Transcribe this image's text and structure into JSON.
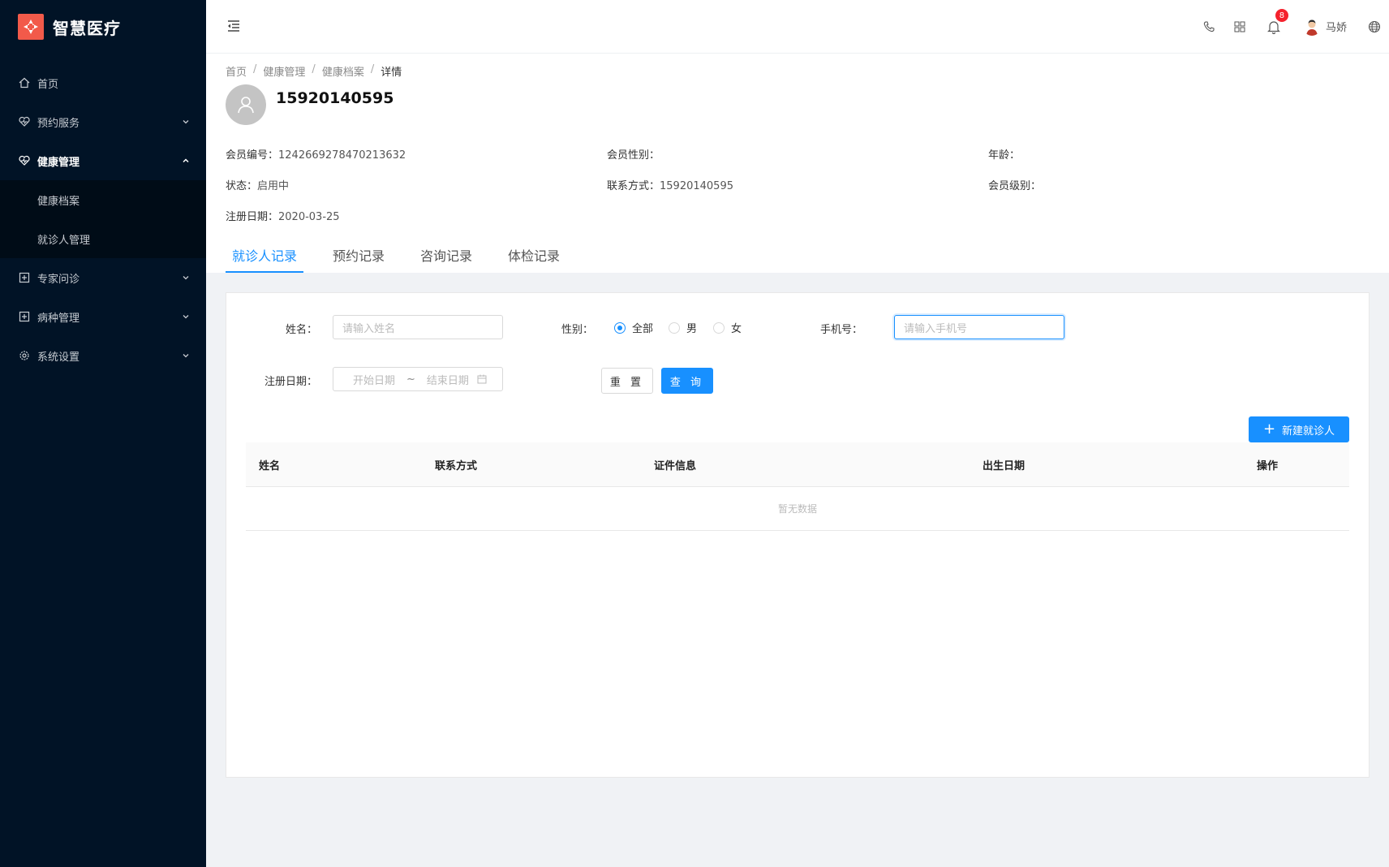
{
  "brand": {
    "title": "智慧医疗",
    "logo_color": "#f25a4a"
  },
  "sidebar": {
    "items": [
      {
        "label": "首页",
        "icon": "home-icon"
      },
      {
        "label": "预约服务",
        "icon": "heart-icon"
      },
      {
        "label": "健康管理",
        "icon": "heart-icon"
      },
      {
        "label": "专家问诊",
        "icon": "plus-square-icon"
      },
      {
        "label": "病种管理",
        "icon": "plus-square-icon"
      },
      {
        "label": "系统设置",
        "icon": "gear-icon"
      }
    ],
    "submenu": [
      {
        "label": "健康档案"
      },
      {
        "label": "就诊人管理"
      }
    ]
  },
  "topbar": {
    "notification_count": "8",
    "username": "马娇"
  },
  "breadcrumb": [
    "首页",
    "健康管理",
    "健康档案",
    "详情"
  ],
  "member": {
    "name": "15920140595",
    "fields": {
      "member_no_label": "会员编号：",
      "member_no": "1242669278470213632",
      "gender_label": "会员性别：",
      "gender": "",
      "age_label": "年龄：",
      "age": "",
      "status_label": "状态：",
      "status": "启用中",
      "contact_label": "联系方式：",
      "contact": "15920140595",
      "level_label": "会员级别：",
      "level": "",
      "reg_date_label": "注册日期：",
      "reg_date": "2020-03-25"
    }
  },
  "tabs": [
    "就诊人记录",
    "预约记录",
    "咨询记录",
    "体检记录"
  ],
  "form": {
    "name_label": "姓名：",
    "name_placeholder": "请输入姓名",
    "gender_label": "性别：",
    "gender_options": [
      "全部",
      "男",
      "女"
    ],
    "phone_label": "手机号：",
    "phone_placeholder": "请输入手机号",
    "date_label": "注册日期：",
    "date_start": "开始日期",
    "date_sep": "~",
    "date_end": "结束日期",
    "reset": "重 置",
    "query": "查 询",
    "new_button": "新建就诊人"
  },
  "table": {
    "columns": [
      "姓名",
      "联系方式",
      "证件信息",
      "出生日期",
      "操作"
    ],
    "empty_text": "暂无数据"
  },
  "colors": {
    "primary": "#1890ff",
    "sidebar_bg": "#011326",
    "badge": "#f5222d"
  }
}
